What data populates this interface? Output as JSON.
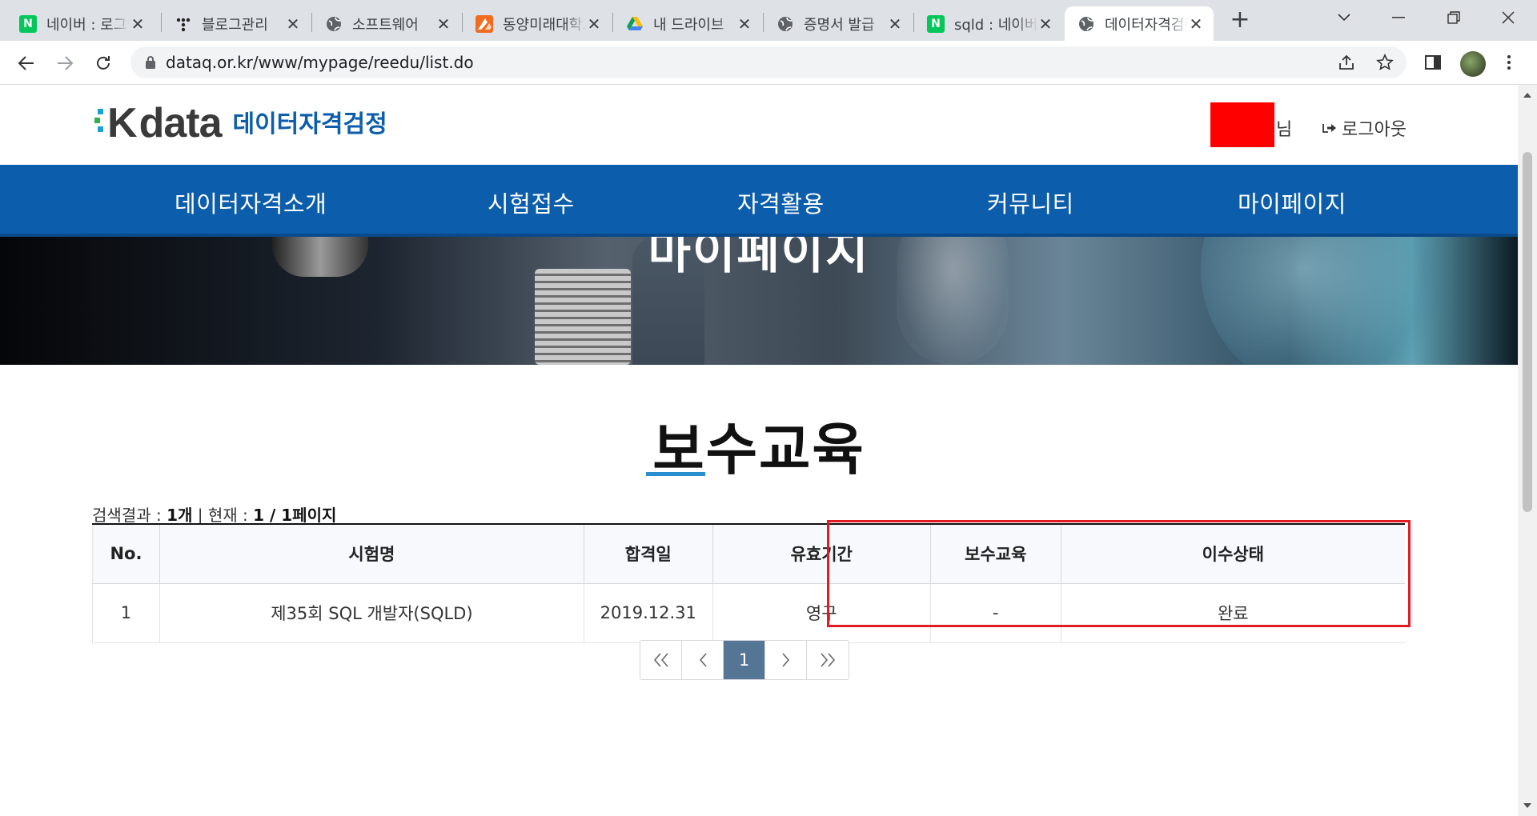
{
  "browser": {
    "tabs": [
      {
        "title": "네이버 : 로그인",
        "icon": "naver-icon"
      },
      {
        "title": "블로그관리",
        "icon": "tistory-icon"
      },
      {
        "title": "소프트웨어",
        "icon": "globe-icon"
      },
      {
        "title": "동양미래대학교",
        "icon": "dongyang-icon"
      },
      {
        "title": "내 드라이브",
        "icon": "google-drive-icon"
      },
      {
        "title": "증명서 발급",
        "icon": "globe-icon"
      },
      {
        "title": "sqld : 네이버",
        "icon": "naver-icon"
      },
      {
        "title": "데이터자격검정",
        "icon": "globe-icon",
        "active": true
      }
    ],
    "url": "dataq.or.kr/www/mypage/reedu/list.do"
  },
  "header": {
    "logo_k": "K",
    "logo_data": "data",
    "logo_text": "데이터자격검정",
    "user_suffix": "님",
    "logout_label": "로그아웃"
  },
  "nav": {
    "items": [
      "데이터자격소개",
      "시험접수",
      "자격활용",
      "커뮤니티",
      "마이페이지"
    ]
  },
  "hero": {
    "title": "마이페이지"
  },
  "main": {
    "title": "보수교육",
    "search_result_label": "검색결과 : ",
    "search_result_count": "1개",
    "separator": " | ",
    "current_label": "현재 : ",
    "current_page": "1 / 1페이지",
    "table": {
      "headers": [
        "No.",
        "시험명",
        "합격일",
        "유효기간",
        "보수교육",
        "이수상태"
      ],
      "rows": [
        [
          "1",
          "제35회 SQL 개발자(SQLD)",
          "2019.12.31",
          "영구",
          "-",
          "완료"
        ]
      ]
    },
    "pagination": {
      "first": "«",
      "prev": "‹",
      "current": "1",
      "next": "›",
      "last": "»"
    }
  },
  "colors": {
    "nav_bg": "#0c5dab",
    "highlight_border": "#e01b24",
    "pager_current": "#557594",
    "title_underline": "#2a8fd1"
  }
}
